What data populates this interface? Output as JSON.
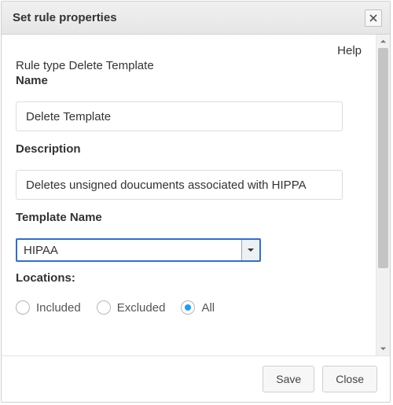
{
  "dialog": {
    "title": "Set rule properties"
  },
  "help": "Help",
  "ruleTypeLine": "Rule type Delete Template",
  "labels": {
    "name": "Name",
    "description": "Description",
    "templateName": "Template Name",
    "locations": "Locations:"
  },
  "fields": {
    "nameValue": "Delete Template",
    "descriptionValue": "Deletes unsigned doucuments associated with HIPPA",
    "templateSelected": "HIPAA"
  },
  "locations": {
    "options": {
      "included": "Included",
      "excluded": "Excluded",
      "all": "All"
    },
    "selected": "all"
  },
  "actions": {
    "save": "Save",
    "close": "Close"
  }
}
